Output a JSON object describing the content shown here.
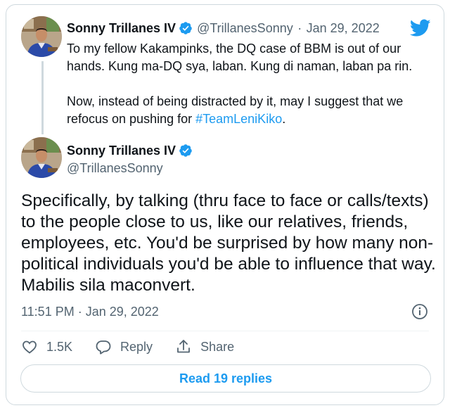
{
  "tweet1": {
    "author_name": "Sonny Trillanes IV",
    "handle": "@TrillanesSonny",
    "separator": "·",
    "date": "Jan 29, 2022",
    "para1": "To my fellow Kakampinks, the DQ case of BBM is out of our hands. Kung ma-DQ sya, laban. Kung di naman, laban pa rin.",
    "para2_prefix": "Now, instead of being distracted by it, may I suggest that we refocus on pushing for ",
    "hashtag": "#TeamLeniKiko",
    "para2_suffix": "."
  },
  "tweet2": {
    "author_name": "Sonny Trillanes IV",
    "handle": "@TrillanesSonny",
    "text": "Specifically, by talking (thru face to face or calls/texts) to the people close to us, like our relatives, friends, employees, etc. You'd be surprised by how many non-political individuals you'd be able to influence that way. Mabilis sila maconvert.",
    "timestamp": "11:51 PM · Jan 29, 2022"
  },
  "actions": {
    "like_count": "1.5K",
    "reply_label": "Reply",
    "share_label": "Share"
  },
  "read_replies_label": "Read 19 replies",
  "colors": {
    "accent": "#1d9bf0",
    "text": "#0f1419",
    "muted": "#536471",
    "border": "#cfd9de"
  }
}
